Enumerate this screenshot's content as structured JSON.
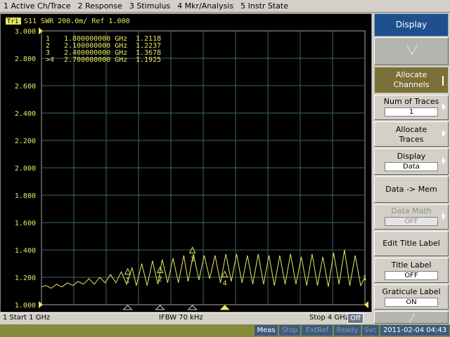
{
  "menu": [
    "1 Active Ch/Trace",
    "2 Response",
    "3 Stimulus",
    "4 Mkr/Analysis",
    "5 Instr State"
  ],
  "trace": {
    "tag": "Tr1",
    "header": "S11  SWR 200.0m/ Ref 1.000",
    "color": "#e8e860"
  },
  "markers": [
    {
      "label": "1",
      "freq": "1.800000000 GHz",
      "value": "1.2118",
      "active": false
    },
    {
      "label": "2",
      "freq": "2.100000000 GHz",
      "value": "1.2237",
      "active": false
    },
    {
      "label": "3",
      "freq": "2.400000000 GHz",
      "value": "1.3678",
      "active": false
    },
    {
      "label": ">4",
      "freq": "2.700000000 GHz",
      "value": "1.1925",
      "active": true
    }
  ],
  "channel": {
    "start": "1  Start 1 GHz",
    "ifbw": "IFBW 70 kHz",
    "stop": "Stop 4 GHz",
    "off": "Off"
  },
  "status": {
    "meas": "Meas",
    "stop": "Stop",
    "extref": "ExtRef",
    "ready": "Ready",
    "svc": "Svc",
    "datetime": "2011-02-04 04:43"
  },
  "softkeys": {
    "title": "Display",
    "allocate_channels": [
      "Allocate",
      "Channels"
    ],
    "num_traces_label": "Num of Traces",
    "num_traces_value": "1",
    "allocate_traces": [
      "Allocate",
      "Traces"
    ],
    "display_label": "Display",
    "display_value": "Data",
    "data_mem": "Data -> Mem",
    "data_math_label": "Data Math",
    "data_math_value": "OFF",
    "edit_title": "Edit Title Label",
    "title_label": "Title Label",
    "title_label_value": "OFF",
    "graticule_label": "Graticule Label",
    "graticule_value": "ON"
  },
  "chart_data": {
    "type": "line",
    "title": "S11  SWR 200.0m/ Ref 1.000",
    "xlabel": "",
    "ylabel": "",
    "xlim": [
      1.0,
      4.0
    ],
    "x_unit": "GHz",
    "ylim": [
      1.0,
      3.0
    ],
    "yticks": [
      "3.000",
      "2.800",
      "2.600",
      "2.400",
      "2.200",
      "2.000",
      "1.800",
      "1.600",
      "1.400",
      "1.200",
      "1.000"
    ],
    "grid": true,
    "series": [
      {
        "color": "#e8e860",
        "x": [
          1.0,
          1.04,
          1.09,
          1.14,
          1.19,
          1.24,
          1.29,
          1.34,
          1.39,
          1.44,
          1.49,
          1.54,
          1.59,
          1.64,
          1.69,
          1.74,
          1.79,
          1.84,
          1.88,
          1.93,
          1.98,
          2.03,
          2.08,
          2.12,
          2.17,
          2.22,
          2.27,
          2.32,
          2.36,
          2.41,
          2.46,
          2.51,
          2.56,
          2.61,
          2.66,
          2.71,
          2.76,
          2.81,
          2.86,
          2.91,
          2.96,
          3.01,
          3.06,
          3.11,
          3.16,
          3.21,
          3.26,
          3.31,
          3.36,
          3.41,
          3.46,
          3.51,
          3.56,
          3.61,
          3.66,
          3.71,
          3.76,
          3.81,
          3.86,
          3.91,
          3.96,
          4.0
        ],
        "y": [
          1.13,
          1.14,
          1.12,
          1.15,
          1.13,
          1.16,
          1.14,
          1.17,
          1.15,
          1.19,
          1.15,
          1.2,
          1.16,
          1.22,
          1.16,
          1.24,
          1.15,
          1.27,
          1.14,
          1.3,
          1.14,
          1.32,
          1.15,
          1.33,
          1.16,
          1.34,
          1.16,
          1.36,
          1.17,
          1.37,
          1.18,
          1.36,
          1.19,
          1.36,
          1.16,
          1.37,
          1.17,
          1.37,
          1.16,
          1.36,
          1.15,
          1.37,
          1.15,
          1.36,
          1.14,
          1.36,
          1.15,
          1.37,
          1.15,
          1.35,
          1.14,
          1.37,
          1.14,
          1.35,
          1.13,
          1.38,
          1.15,
          1.4,
          1.14,
          1.36,
          1.14,
          1.2
        ]
      }
    ],
    "marker_points": [
      {
        "label": "1",
        "x": 1.8,
        "y": 1.2118
      },
      {
        "label": "2",
        "x": 2.1,
        "y": 1.2237
      },
      {
        "label": "3",
        "x": 2.4,
        "y": 1.3678
      },
      {
        "label": "4",
        "x": 2.7,
        "y": 1.1925
      }
    ]
  }
}
